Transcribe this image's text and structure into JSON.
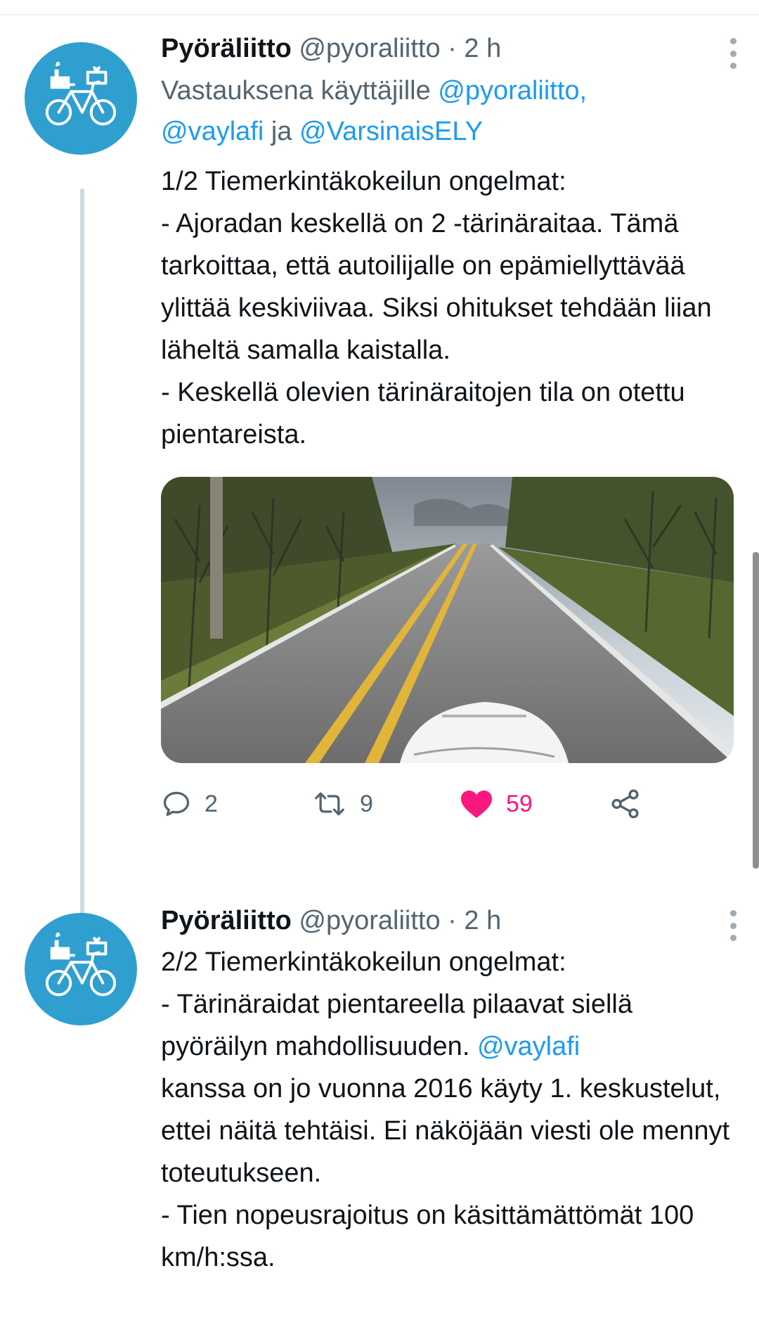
{
  "tweets": [
    {
      "name": "Pyöräliitto",
      "handle": "@pyoraliitto",
      "separator": "·",
      "time": "2 h",
      "reply_prefix": "Vastauksena käyttäjille",
      "reply_mention_1": "@pyoraliitto,",
      "reply_mention_2": "@vaylafi",
      "reply_and": "ja",
      "reply_mention_3": "@VarsinaisELY",
      "text": "1/2 Tiemerkintäkokeilun ongelmat:\n- Ajoradan keskellä on 2 -tärinäraitaa. Tämä tarkoittaa, että autoilijalle on epämiellyttävää ylittää keskiviivaa. Siksi ohitukset tehdään liian läheltä samalla kaistalla.\n- Keskellä olevien tärinäraitojen tila on otettu pientareista.",
      "replies": "2",
      "retweets": "9",
      "likes": "59"
    },
    {
      "name": "Pyöräliitto",
      "handle": "@pyoraliitto",
      "separator": "·",
      "time": "2 h",
      "text_part1": "2/2 Tiemerkintäkokeilun ongelmat:\n- Tärinäraidat pientareella pilaavat siellä pyöräilyn mahdollisuuden. ",
      "text_mention": "@vaylafi",
      "text_part2": "\nkanssa on jo vuonna 2016 käyty 1. keskustelut, ettei näitä tehtäisi. Ei näköjään viesti ole mennyt toteutukseen.\n- Tien nopeusrajoitus on käsittämättömät 100 km/h:ssa."
    }
  ],
  "colors": {
    "avatar_bg": "#2f9fd0",
    "link": "#1d9bf0",
    "secondary_text": "#536471",
    "like_active": "#f91880",
    "thread_line": "#cfd9de"
  },
  "icons": {
    "avatar": "bicycle-logo-icon",
    "reply": "reply-icon",
    "retweet": "retweet-icon",
    "like": "heart-icon",
    "share": "share-icon",
    "more": "more-vertical-icon"
  }
}
